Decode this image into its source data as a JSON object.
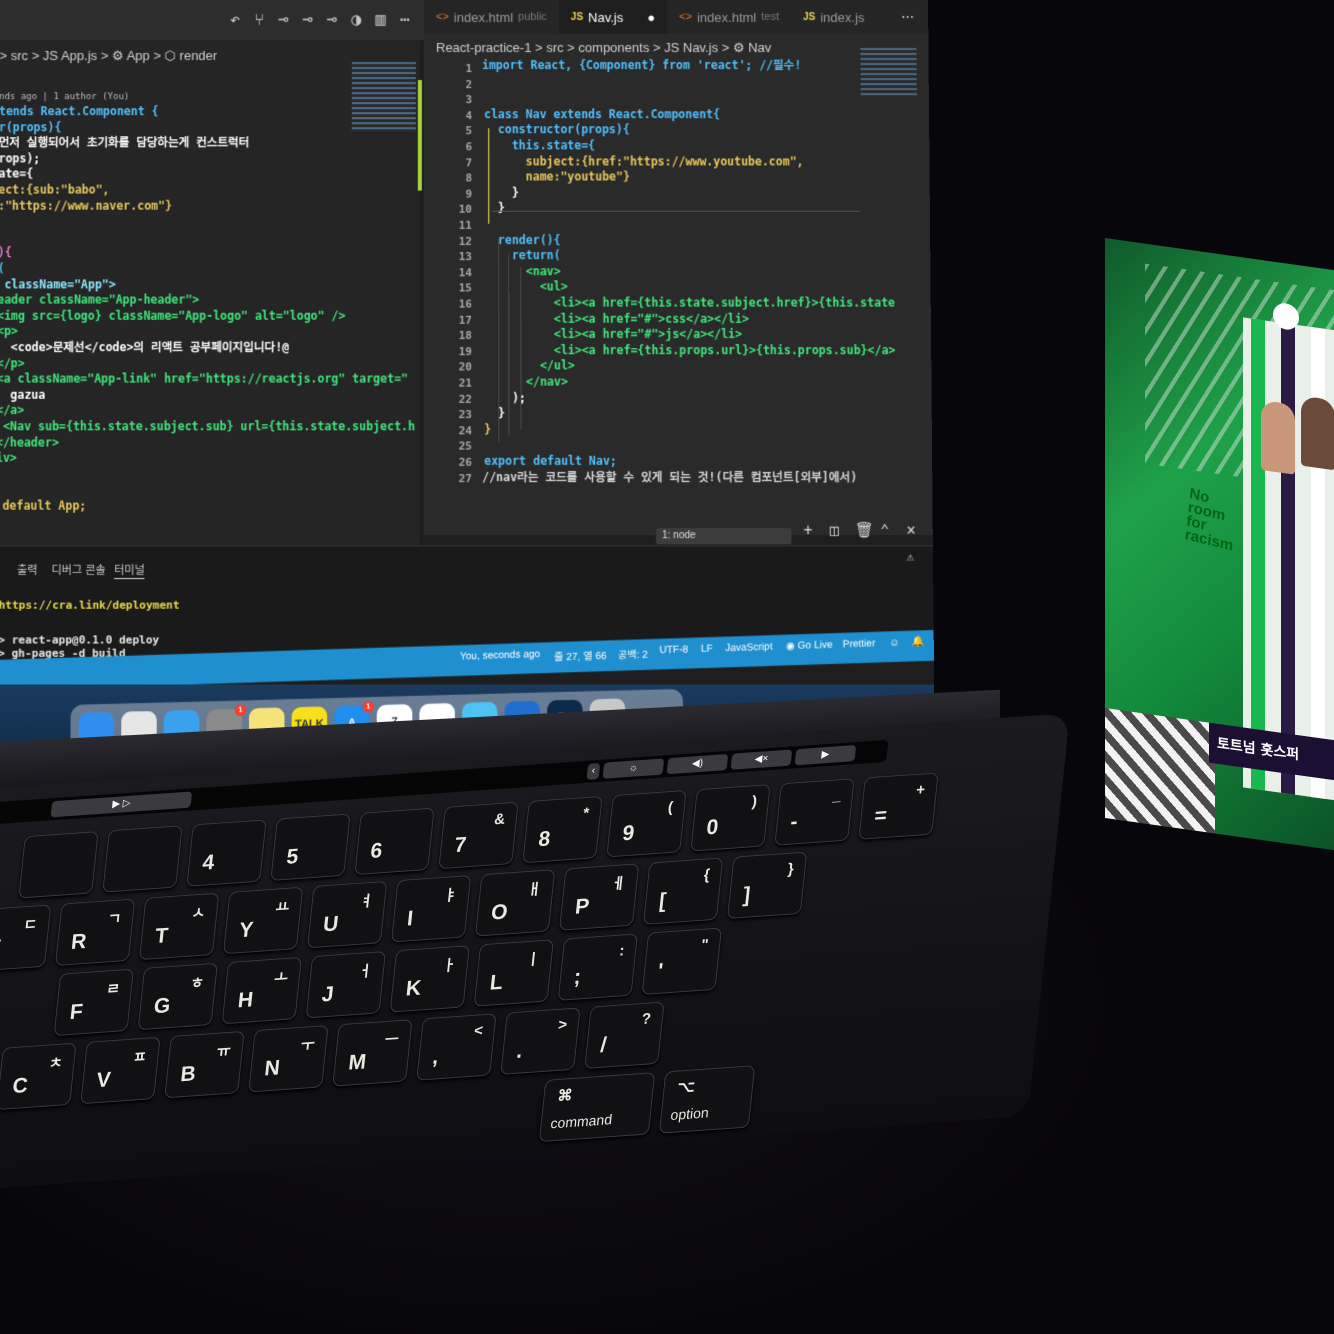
{
  "editor": {
    "left_breadcrumb": "> src > JS App.js > ⚙ App > ⬡ render",
    "left_blame": "nds ago | 1 author (You)",
    "left_code": [
      "tends React.Component {",
      "r(props){",
      "먼저 실행되어서 초기화를 담당하는게 컨스트럭터",
      "rops);",
      "ate={",
      "ect:{sub:\"babo\",",
      ":\"https://www.naver.com\"}",
      "",
      "",
      "){",
      "(",
      " className=\"App\">",
      "eader className=\"App-header\">",
      "<img src={logo} className=\"App-logo\" alt=\"logo\" />",
      "<p>",
      "  <code>문제선</code>의 리액트 공부페이지입니다!@",
      "</p>",
      "<a className=\"App-link\" href=\"https://reactjs.org\" target=\"",
      "  gazua",
      "</a>",
      " <Nav sub={this.state.subject.sub} url={this.state.subject.h",
      "</header>",
      "iv>",
      "",
      "",
      " default App;"
    ],
    "tabs": [
      {
        "icon": "<>",
        "label": "index.html",
        "sub": "public"
      },
      {
        "icon": "JS",
        "label": "Nav.js",
        "sub": ""
      },
      {
        "icon": "<>",
        "label": "index.html",
        "sub": "test"
      },
      {
        "icon": "JS",
        "label": "index.js",
        "sub": ""
      }
    ],
    "right_breadcrumb": "React-practice-1 > src > components > JS Nav.js > ⚙ Nav",
    "line_numbers": [
      "1",
      "2",
      "3",
      "4",
      "5",
      "6",
      "7",
      "8",
      "9",
      "10",
      "11",
      "12",
      "13",
      "14",
      "15",
      "16",
      "17",
      "18",
      "19",
      "20",
      "21",
      "22",
      "23",
      "24",
      "25",
      "26",
      "27"
    ],
    "right_code": [
      "import React, {Component} from 'react'; //필수!",
      "",
      "",
      "class Nav extends React.Component{",
      "  constructor(props){",
      "    this.state={",
      "      subject:{href:\"https://www.youtube.com\",",
      "      name:\"youtube\"}",
      "    }",
      "  }",
      "",
      "  render(){",
      "    return(",
      "      <nav>",
      "        <ul>",
      "          <li><a href={this.state.subject.href}>{this.state",
      "          <li><a href=\"#\">css</a></li>",
      "          <li><a href=\"#\">js</a></li>",
      "          <li><a href={this.props.url}>{this.props.sub}</a>",
      "        </ul>",
      "      </nav>",
      "    );",
      "  }",
      "}",
      "",
      "export default Nav;",
      "//nav라는 코드를 사용할 수 있게 되는 것!(다른 컴포넌트[외부]에서)"
    ]
  },
  "panel": {
    "tabs": [
      "출력",
      "디버그 콘솔",
      "터미널"
    ],
    "terminal_select": "1: node",
    "terminal_lines": [
      "https://cra.link/deployment",
      "",
      "> react-app@0.1.0 deploy",
      "> gh-pages -d build"
    ]
  },
  "statusbar": {
    "blame": "You, seconds ago",
    "position": "줄 27, 열 66",
    "spaces": "공백: 2",
    "encoding": "UTF-8",
    "eol": "LF",
    "language": "JavaScript",
    "golive": "Go Live",
    "prettier": "Prettier"
  },
  "dock": {
    "apps": [
      {
        "name": "finder-icon",
        "label": "",
        "color": "#2f8ff0"
      },
      {
        "name": "launchpad-icon",
        "label": "",
        "color": "#e6e6e6"
      },
      {
        "name": "safari-icon",
        "label": "",
        "color": "#3aa0f0"
      },
      {
        "name": "system-preferences-icon",
        "label": "",
        "color": "#8a8a8a",
        "badge": "1"
      },
      {
        "name": "notes-icon",
        "label": "",
        "color": "#f7e27a"
      },
      {
        "name": "kakaotalk-icon",
        "label": "TALK",
        "color": "#f9df1b"
      },
      {
        "name": "app-store-icon",
        "label": "A",
        "color": "#1f8ef1",
        "badge": "1"
      },
      {
        "name": "calendar-icon",
        "label": "7",
        "color": "#ffffff"
      },
      {
        "name": "chrome-icon",
        "label": "",
        "color": "#ffffff"
      },
      {
        "name": "whale-icon",
        "label": "",
        "color": "#4cc3f0"
      },
      {
        "name": "vscode-icon",
        "label": "",
        "color": "#1e6fd0"
      },
      {
        "name": "photoshop-icon",
        "label": "Ps",
        "color": "#0b2a4a"
      },
      {
        "name": "trash-icon",
        "label": "",
        "color": "#c8c8c8"
      }
    ]
  },
  "keyboard": {
    "row1": [
      {
        "l": "",
        "h": ""
      },
      {
        "l": "",
        "h": ""
      },
      {
        "l": "4",
        "h": ""
      },
      {
        "l": "5",
        "h": ""
      },
      {
        "l": "6",
        "h": ""
      },
      {
        "l": "7",
        "h": "&"
      },
      {
        "l": "8",
        "h": "*"
      },
      {
        "l": "9",
        "h": "("
      },
      {
        "l": "0",
        "h": ")"
      },
      {
        "l": "-",
        "h": "_"
      },
      {
        "l": "=",
        "h": "+"
      }
    ],
    "row2": [
      {
        "l": "E",
        "h": "ㄷ"
      },
      {
        "l": "R",
        "h": "ㄱ"
      },
      {
        "l": "T",
        "h": "ㅅ"
      },
      {
        "l": "Y",
        "h": "ㅛ"
      },
      {
        "l": "U",
        "h": "ㅕ"
      },
      {
        "l": "I",
        "h": "ㅑ"
      },
      {
        "l": "O",
        "h": "ㅐ"
      },
      {
        "l": "P",
        "h": "ㅔ"
      },
      {
        "l": "[",
        "h": "{"
      },
      {
        "l": "]",
        "h": "}"
      }
    ],
    "row3": [
      {
        "l": "F",
        "h": "ㄹ"
      },
      {
        "l": "G",
        "h": "ㅎ"
      },
      {
        "l": "H",
        "h": "ㅗ"
      },
      {
        "l": "J",
        "h": "ㅓ"
      },
      {
        "l": "K",
        "h": "ㅏ"
      },
      {
        "l": "L",
        "h": "ㅣ"
      },
      {
        "l": ";",
        "h": ":"
      },
      {
        "l": "'",
        "h": "\""
      }
    ],
    "row4": [
      {
        "l": "C",
        "h": "ㅊ"
      },
      {
        "l": "V",
        "h": "ㅍ"
      },
      {
        "l": "B",
        "h": "ㅠ"
      },
      {
        "l": "N",
        "h": "ㅜ"
      },
      {
        "l": "M",
        "h": "ㅡ"
      },
      {
        "l": ",",
        "h": "<"
      },
      {
        "l": ".",
        "h": ">"
      },
      {
        "l": "/",
        "h": "?"
      }
    ],
    "command_label": "command",
    "command_symbol": "⌘",
    "option_label": "option",
    "option_symbol": "⌥"
  },
  "phone": {
    "slogan": "No room for racism",
    "banner": "토트넘 홋스퍼"
  }
}
